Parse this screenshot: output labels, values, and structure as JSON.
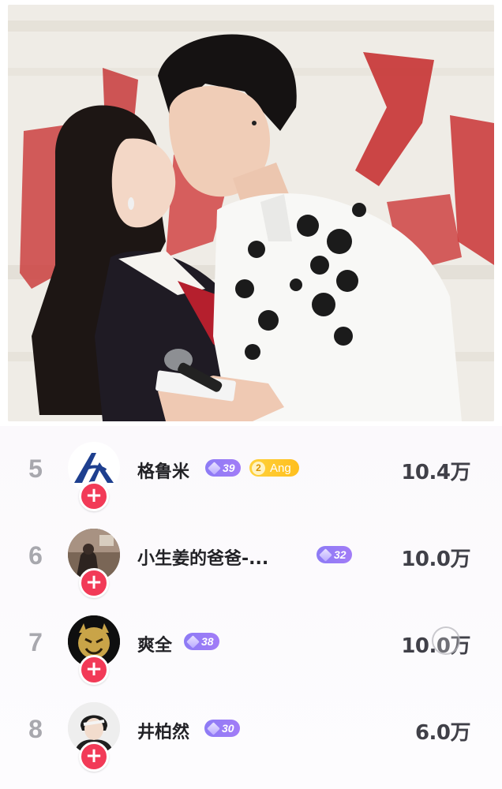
{
  "photo": {
    "icon": "event-photo"
  },
  "leaderboard": {
    "rows": [
      {
        "rank": "5",
        "name": "格鲁米",
        "level": "39",
        "fan_badge_level": "2",
        "fan_badge_name": "Ang",
        "score": "10.4万",
        "avatar": "logo-avatar"
      },
      {
        "rank": "6",
        "name": "小生姜的爸爸-...",
        "level": "32",
        "score": "10.0万",
        "avatar": "photo-avatar"
      },
      {
        "rank": "7",
        "name": "爽全",
        "level": "38",
        "score": "10.0万",
        "avatar": "devil-emoji-avatar"
      },
      {
        "rank": "8",
        "name": "井柏然",
        "level": "30",
        "score": "6.0万",
        "avatar": "portrait-avatar"
      }
    ],
    "follow_label": "+"
  },
  "colors": {
    "follow": "#f23a57",
    "level_badge": "#8d7bf5",
    "fan_badge": "#ffc82a",
    "rank": "#a8a8ae"
  }
}
